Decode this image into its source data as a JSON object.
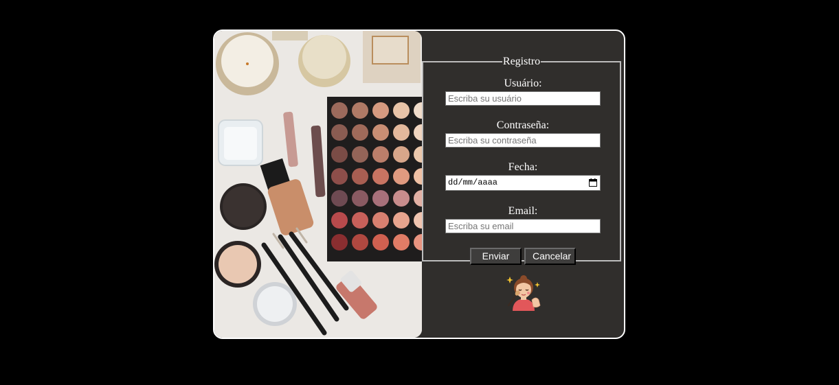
{
  "form": {
    "legend": "Registro",
    "fields": [
      {
        "label": "Usuário:",
        "placeholder": "Escriba su usuário",
        "type": "text"
      },
      {
        "label": "Contraseña:",
        "placeholder": "Escriba su contraseña",
        "type": "password"
      },
      {
        "label": "Fecha:",
        "value": "dd/mm/aaaa",
        "type": "date"
      },
      {
        "label": "Email:",
        "placeholder": "Escriba su email",
        "type": "email"
      }
    ],
    "submit_label": "Enviar",
    "cancel_label": "Cancelar"
  },
  "icons": {
    "calendar": "calendar-icon",
    "avatar": "makeup-woman-icon"
  },
  "colors": {
    "page_background": "#000000",
    "panel_background": "#302e2c",
    "card_border": "#ffffff",
    "button_background": "#3e3d3c"
  }
}
